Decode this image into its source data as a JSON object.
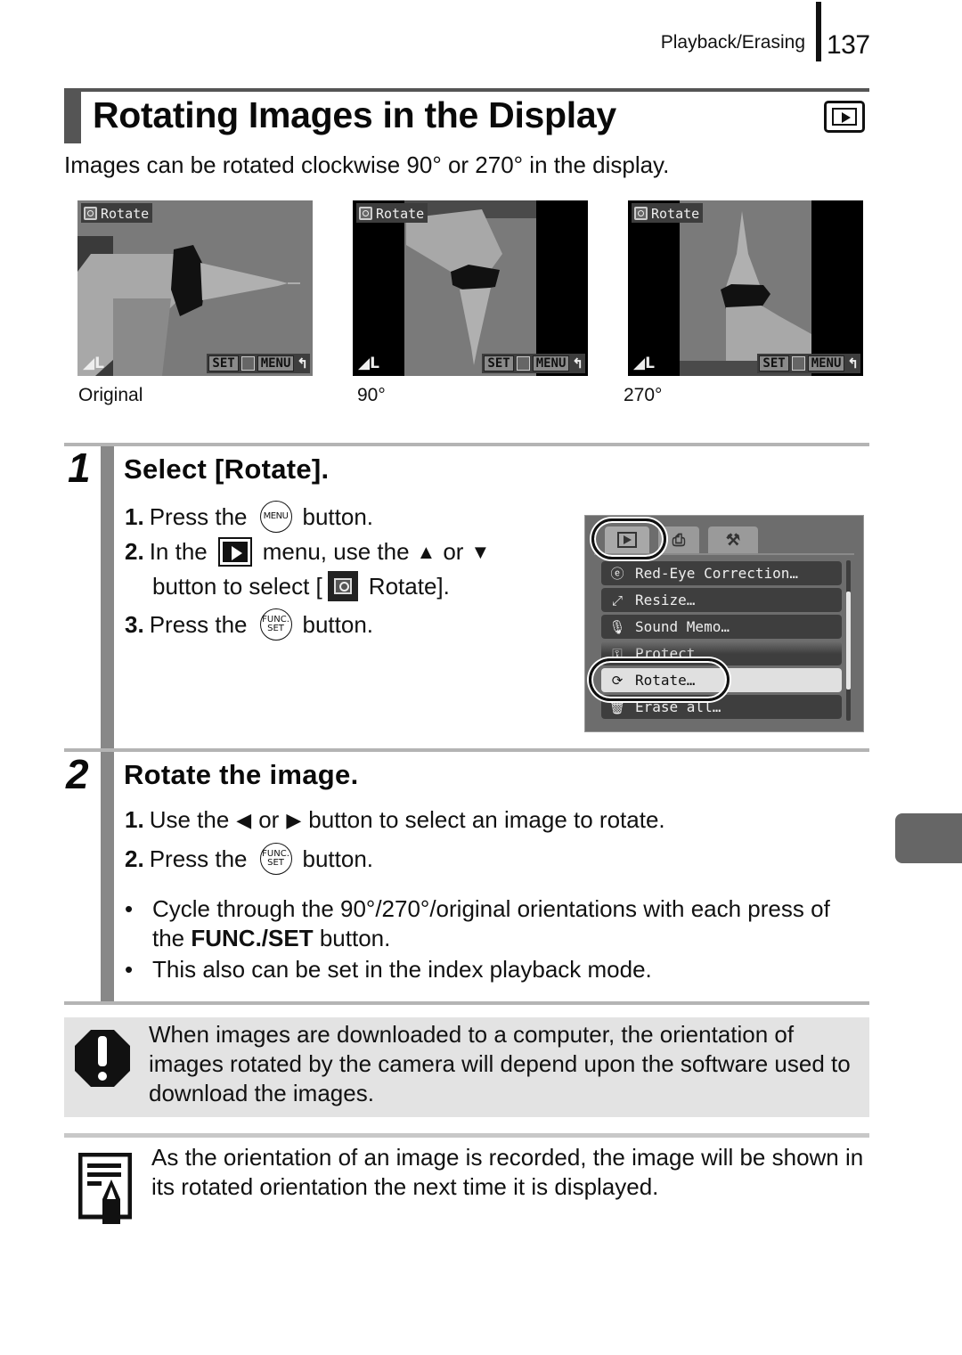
{
  "header": {
    "section": "Playback/Erasing",
    "page_number": "137"
  },
  "title": "Rotating Images in the Display",
  "mode_icon": "playback-mode-icon",
  "intro": "Images can be rotated clockwise 90° or 270° in the display.",
  "screenshots": [
    {
      "caption": "Original",
      "osd_label": "Rotate",
      "osd_size": "L",
      "osd_buttons": [
        "SET",
        "MENU"
      ]
    },
    {
      "caption": "90°",
      "osd_label": "Rotate",
      "osd_size": "L",
      "osd_buttons": [
        "SET",
        "MENU"
      ]
    },
    {
      "caption": "270°",
      "osd_label": "Rotate",
      "osd_size": "L",
      "osd_buttons": [
        "SET",
        "MENU"
      ]
    }
  ],
  "steps": [
    {
      "number": "1",
      "title": "Select [Rotate].",
      "instructions": [
        {
          "n": "1.",
          "before": "Press the",
          "button": "MENU",
          "after": "button."
        },
        {
          "n": "2.",
          "before": "In the",
          "icon": "playback-menu-icon",
          "middle": "menu, use the",
          "arrow1": "▲",
          "or": "or",
          "arrow2": "▼"
        },
        {
          "cont_before": "button to select [",
          "icon": "rotate-icon",
          "cont_after": "Rotate]."
        },
        {
          "n": "3.",
          "before": "Press the",
          "button_top": "FUNC.",
          "button_bottom": "SET",
          "after": "button."
        }
      ],
      "camera_menu": {
        "tabs": [
          "play",
          "print",
          "setup"
        ],
        "active_tab": "play",
        "items": [
          {
            "icon": "red-eye-icon",
            "label": "Red-Eye Correction…"
          },
          {
            "icon": "resize-icon",
            "label": "Resize…"
          },
          {
            "icon": "sound-memo-icon",
            "label": "Sound Memo…"
          },
          {
            "icon": "protect-key-icon",
            "label": "Protect"
          },
          {
            "icon": "rotate-icon",
            "label": "Rotate…",
            "selected": true
          },
          {
            "icon": "trash-icon",
            "label": "Erase all…"
          }
        ]
      }
    },
    {
      "number": "2",
      "title": "Rotate the image.",
      "instructions": [
        {
          "n": "1.",
          "before": "Use the",
          "arrow1": "◀",
          "or": "or",
          "arrow2": "▶",
          "after": "button to select an image to rotate."
        },
        {
          "n": "2.",
          "before": "Press the",
          "button_top": "FUNC.",
          "button_bottom": "SET",
          "after": "button."
        }
      ],
      "bullets": [
        {
          "before": "Cycle through the 90°/270°/original orientations with each press of the ",
          "bold": "FUNC./SET",
          "after": " button."
        },
        {
          "text": "This also can be set in the index playback mode."
        }
      ]
    }
  ],
  "caution": {
    "icon": "caution-icon",
    "text": "When images are downloaded to a computer, the orientation of images rotated by the camera will depend upon the software used to download the images."
  },
  "note": {
    "icon": "note-pencil-icon",
    "text": "As the orientation of an image is recorded, the image will be shown in its rotated orientation the next time it is displayed."
  }
}
